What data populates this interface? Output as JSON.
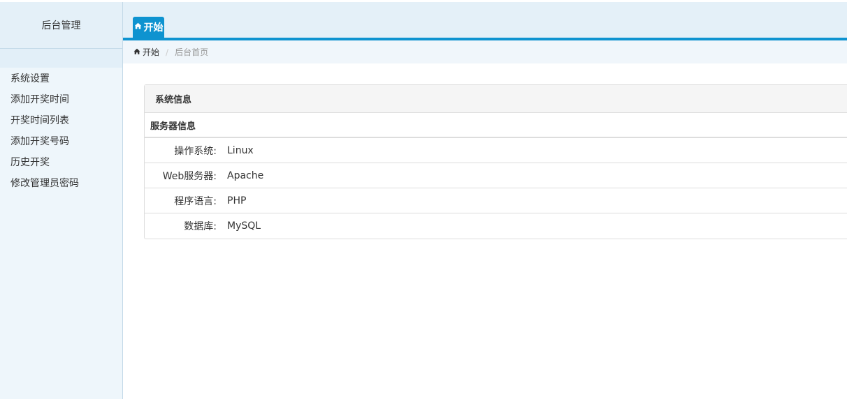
{
  "sidebar": {
    "title": "后台管理",
    "items": [
      {
        "label": "系统设置"
      },
      {
        "label": "添加开奖时间"
      },
      {
        "label": "开奖时间列表"
      },
      {
        "label": "添加开奖号码"
      },
      {
        "label": "历史开奖"
      },
      {
        "label": "修改管理员密码"
      }
    ]
  },
  "tabs": [
    {
      "label": "开始",
      "icon": "home-icon",
      "active": true
    }
  ],
  "breadcrumb": {
    "home": "开始",
    "current": "后台首页"
  },
  "panel": {
    "title": "系统信息",
    "section_title": "服务器信息",
    "rows": [
      {
        "label": "操作系统:",
        "value": "Linux"
      },
      {
        "label": "Web服务器:",
        "value": "Apache"
      },
      {
        "label": "程序语言:",
        "value": "PHP"
      },
      {
        "label": "数据库:",
        "value": "MySQL"
      }
    ]
  },
  "colors": {
    "accent": "#0e93d0",
    "sidebar_bg": "#eef6fb",
    "header_bg": "#e4f0f8"
  }
}
